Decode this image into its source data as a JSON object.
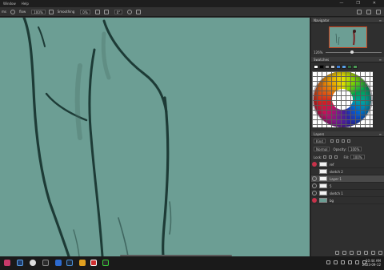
{
  "menubar": {
    "items": [
      "Window",
      "Help"
    ],
    "controls": [
      "—",
      "❐",
      "✕"
    ]
  },
  "options": {
    "mode_label": "ms",
    "flow_label": "flow",
    "flow_value": "100%",
    "smoothing_label": "Smoothing",
    "smoothing_value": "0%",
    "angle_value": "0°"
  },
  "navigator": {
    "title": "Navigator",
    "zoom": "126%"
  },
  "swatches": {
    "title": "Swatches",
    "colors": [
      "#ffffff",
      "#000000",
      "#7f7f7f",
      "#c0c0c0",
      "#3d7fd6",
      "#5aa0e6",
      "#2f6d3f",
      "#4c9a55"
    ]
  },
  "layers": {
    "title": "Layers",
    "filter_label": "Kind",
    "blend_mode": "Normal",
    "opacity_label": "Opacity:",
    "opacity_value": "100%",
    "lock_label": "Lock:",
    "fill_label": "Fill:",
    "fill_value": "100%",
    "items": [
      {
        "name": "ref",
        "visible": true,
        "active": false
      },
      {
        "name": "sketch 2",
        "visible": false,
        "active": false
      },
      {
        "name": "Layer 1",
        "visible": true,
        "active": true
      },
      {
        "name": "5",
        "visible": true,
        "active": false
      },
      {
        "name": "sketch 1",
        "visible": true,
        "active": false
      },
      {
        "name": "bg",
        "visible": true,
        "active": false
      }
    ]
  },
  "canvas": {
    "background": "#6c9e94",
    "stroke_color": "#1d3b36"
  },
  "taskbar": {
    "time": "10:44 AM",
    "date": "2023-09-12"
  }
}
